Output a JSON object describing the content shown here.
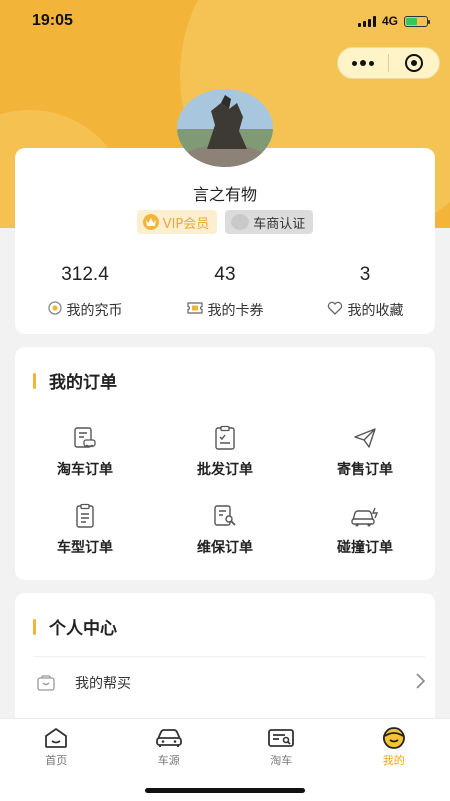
{
  "status_bar": {
    "time": "19:05",
    "network": "4G"
  },
  "user": {
    "name": "言之有物"
  },
  "badges": {
    "vip": "VIP会员",
    "dealer": "车商认证"
  },
  "stats": [
    {
      "value": "312.4",
      "label": "我的究币",
      "icon": "coin-icon"
    },
    {
      "value": "43",
      "label": "我的卡券",
      "icon": "ticket-icon"
    },
    {
      "value": "3",
      "label": "我的收藏",
      "icon": "heart-icon"
    }
  ],
  "orders": {
    "title": "我的订单",
    "items": [
      {
        "label": "淘车订单",
        "icon": "car-order-icon"
      },
      {
        "label": "批发订单",
        "icon": "wholesale-order-icon"
      },
      {
        "label": "寄售订单",
        "icon": "send-icon"
      },
      {
        "label": "车型订单",
        "icon": "clipboard-icon"
      },
      {
        "label": "维保订单",
        "icon": "maintenance-icon"
      },
      {
        "label": "碰撞订单",
        "icon": "collision-icon"
      }
    ]
  },
  "personal": {
    "title": "个人中心",
    "items": [
      {
        "label": "我的帮买",
        "icon": "cart-icon"
      }
    ]
  },
  "tabbar": {
    "items": [
      {
        "label": "首页",
        "icon": "home-icon"
      },
      {
        "label": "车源",
        "icon": "car-icon"
      },
      {
        "label": "淘车",
        "icon": "search-car-icon"
      },
      {
        "label": "我的",
        "icon": "profile-icon"
      }
    ],
    "active": "我的"
  },
  "colors": {
    "accent": "#f3b43a",
    "active_tab": "#f0a41c"
  }
}
